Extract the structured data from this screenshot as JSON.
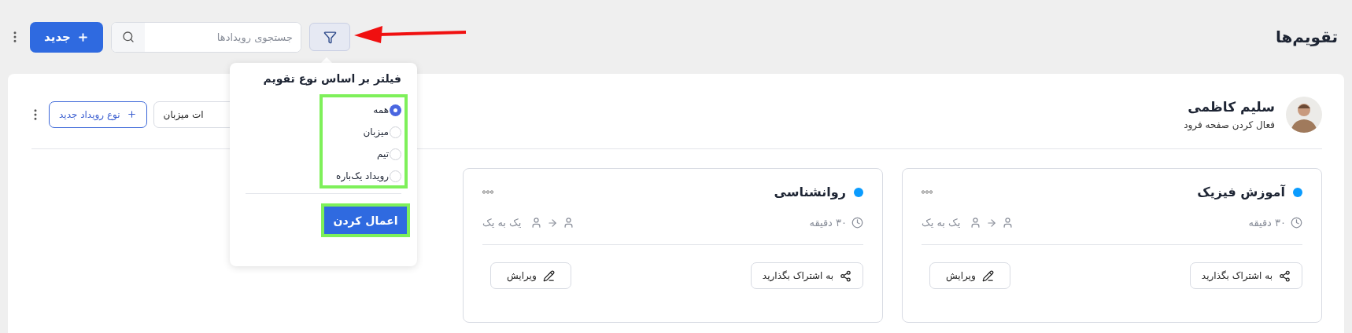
{
  "header": {
    "title": "تقویم‌ها",
    "new_button": "جدید",
    "search": {
      "placeholder": "جستجوی رویدادها"
    }
  },
  "filter_popup": {
    "title": "فیلتر بر اساس نوع تقویم",
    "options": [
      {
        "label": "همه",
        "selected": true
      },
      {
        "label": "میزبان",
        "selected": false
      },
      {
        "label": "تیم",
        "selected": false
      },
      {
        "label": "رویداد یک‌باره",
        "selected": false
      }
    ],
    "apply": "اعمال کردن"
  },
  "profile": {
    "name": "سلیم کاظمی",
    "subtitle": "فعال کردن صفحه فرود",
    "host_settings": "ات میزبان",
    "new_event_type": "نوع رویداد جدید"
  },
  "event_types": [
    {
      "title": "آموزش فیزیک",
      "color": "#0a9bfe",
      "duration": "۳۰ دقیقه",
      "type": "یک به یک",
      "share": "به اشتراک بگذارید",
      "edit": "ویرایش"
    },
    {
      "title": "روانشناسی",
      "color": "#0a9bfe",
      "duration": "۳۰ دقیقه",
      "type": "یک به یک",
      "share": "به اشتراک بگذارید",
      "edit": "ویرایش"
    }
  ]
}
